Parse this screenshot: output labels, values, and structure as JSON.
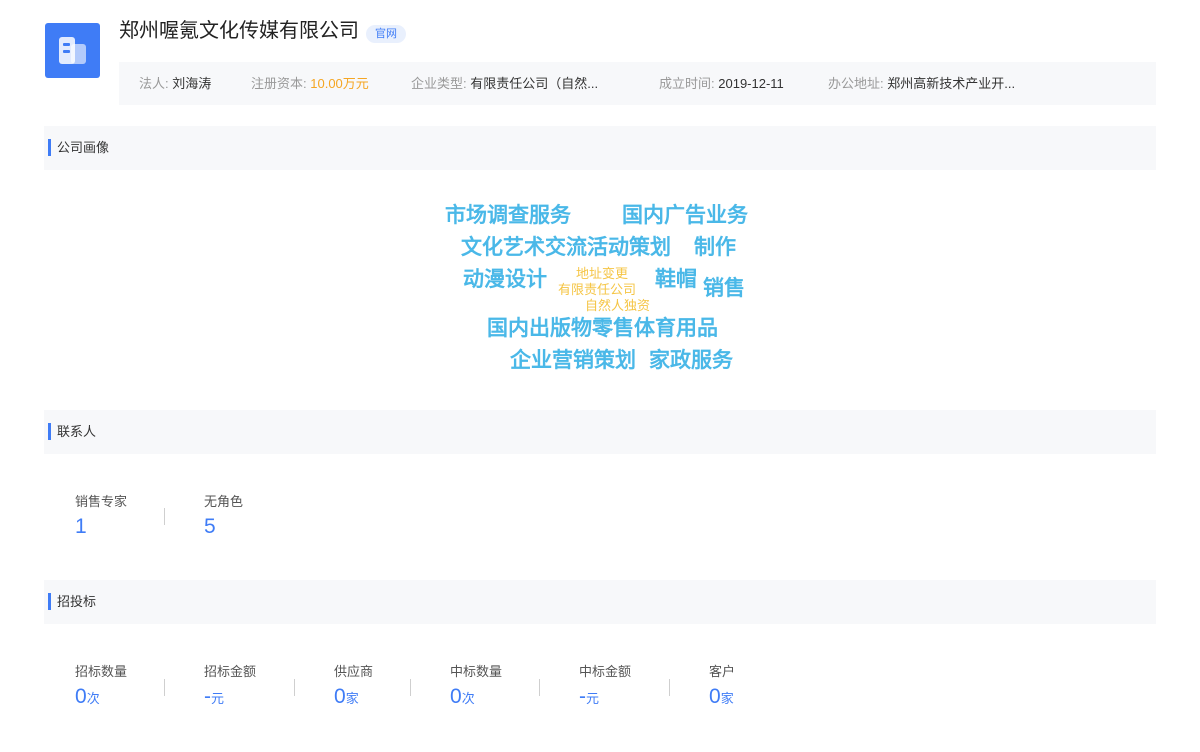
{
  "company": {
    "name": "郑州喔氪文化传媒有限公司",
    "badge": "官网",
    "logo_color": "#3f7cf6"
  },
  "info": [
    {
      "key": "法人:",
      "value": "刘海涛"
    },
    {
      "key": "注册资本:",
      "value": "10.00万元"
    },
    {
      "key": "企业类型:",
      "value": "有限责任公司（自然..."
    },
    {
      "key": "成立时间:",
      "value": "2019-12-11"
    },
    {
      "key": "办公地址:",
      "value": "郑州高新技术产业开..."
    }
  ],
  "sections": {
    "portrait": "公司画像",
    "contacts": "联系人",
    "bidding": "招投标"
  },
  "word_cloud": [
    "市场调查服务",
    "国内广告业务",
    "文化艺术交流活动策划",
    "制作",
    "动漫设计",
    "地址变更",
    "有限责任公司",
    "自然人独资",
    "鞋帽",
    "销售",
    "国内出版物零售体育用品",
    "企业营销策划",
    "家政服务"
  ],
  "contacts": [
    {
      "label": "销售专家",
      "value": "1"
    },
    {
      "label": "无角色",
      "value": "5"
    }
  ],
  "bidding": [
    {
      "label": "招标数量",
      "value": "0",
      "unit": "次"
    },
    {
      "label": "招标金额",
      "value": "-",
      "unit": "元"
    },
    {
      "label": "供应商",
      "value": "0",
      "unit": "家"
    },
    {
      "label": "中标数量",
      "value": "0",
      "unit": "次"
    },
    {
      "label": "中标金额",
      "value": "-",
      "unit": "元"
    },
    {
      "label": "客户",
      "value": "0",
      "unit": "家"
    }
  ],
  "colors": {
    "accent": "#3f7cf6",
    "highlight": "#f5a623",
    "cloud_primary": "#4ab8e8",
    "cloud_secondary": "#f5c545"
  }
}
